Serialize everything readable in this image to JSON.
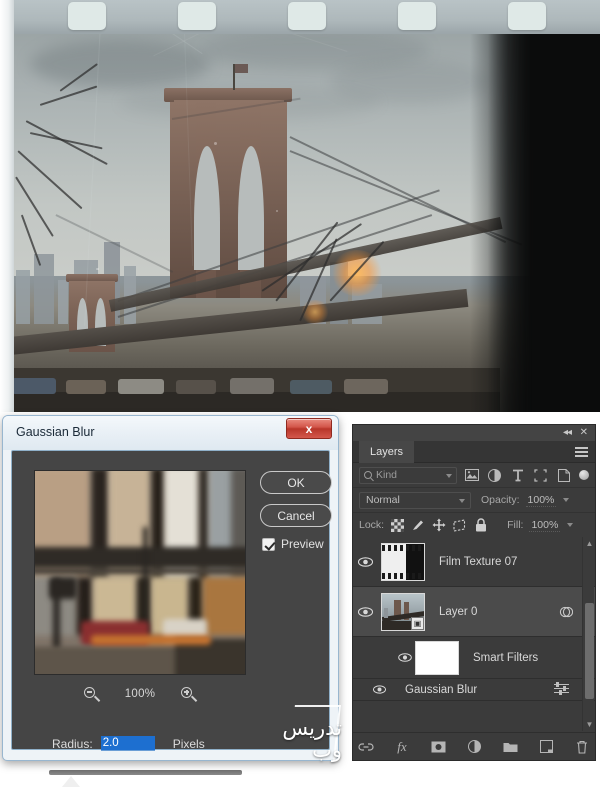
{
  "canvas": {
    "name": "brooklyn-bridge-film-photo",
    "description": "Brooklyn Bridge photo with film-strip texture overlay"
  },
  "dialog": {
    "title": "Gaussian Blur",
    "close_label": "x",
    "ok_label": "OK",
    "cancel_label": "Cancel",
    "preview_label": "Preview",
    "preview_checked": true,
    "zoom_value": "100%",
    "zoom_out_icon": "zoom-out-icon",
    "zoom_in_icon": "zoom-in-icon",
    "radius_label": "Radius:",
    "radius_value": "2.0",
    "radius_units": "Pixels",
    "watermark_text": "تدریس وب"
  },
  "layers_panel": {
    "tab_label": "Layers",
    "collapse_icon": "◂◂",
    "close_icon": "✕",
    "menu_icon": "panel-menu-icon",
    "filter": {
      "search_placeholder": "Kind",
      "icons": [
        "pixel-layer-filter-icon",
        "adjustment-layer-filter-icon",
        "type-layer-filter-icon",
        "shape-layer-filter-icon",
        "smart-object-filter-icon"
      ],
      "toggle_label": "filter-toggle"
    },
    "blend_mode": "Normal",
    "opacity_label": "Opacity:",
    "opacity_value": "100%",
    "lock_label": "Lock:",
    "lock_icons": [
      "lock-transparent-pixels-icon",
      "lock-image-pixels-icon",
      "lock-position-icon",
      "lock-artboard-nesting-icon",
      "lock-all-icon"
    ],
    "fill_label": "Fill:",
    "fill_value": "100%",
    "layers": [
      {
        "name": "Film Texture 07",
        "visible": true,
        "selected": false,
        "thumb": "film-strip-thumbnail",
        "has_smart_badge": false
      },
      {
        "name": "Layer 0",
        "visible": true,
        "selected": true,
        "thumb": "bridge-photo-thumbnail",
        "has_smart_badge": true
      }
    ],
    "smart_filters": {
      "label": "Smart Filters",
      "visible": true,
      "mask_thumb": "smart-filter-mask-thumbnail",
      "filters": [
        {
          "name": "Gaussian Blur",
          "visible": true
        }
      ]
    },
    "toolbar_icons": [
      "link-layers-icon",
      "layer-style-fx-icon",
      "add-layer-mask-icon",
      "new-adjustment-layer-icon",
      "new-group-icon",
      "new-layer-icon",
      "delete-layer-icon"
    ],
    "scrollbar": {
      "up_arrow": "▲",
      "down_arrow": "▼"
    }
  },
  "colors": {
    "dialog_bg": "#eef3f7",
    "dialog_body": "#454545",
    "panel_bg": "#3b3b3b",
    "selected_row": "#4b4b4b",
    "accent_blue": "#1d6fd0",
    "close_red": "#d3564a",
    "text_light": "#d8d8d8"
  }
}
